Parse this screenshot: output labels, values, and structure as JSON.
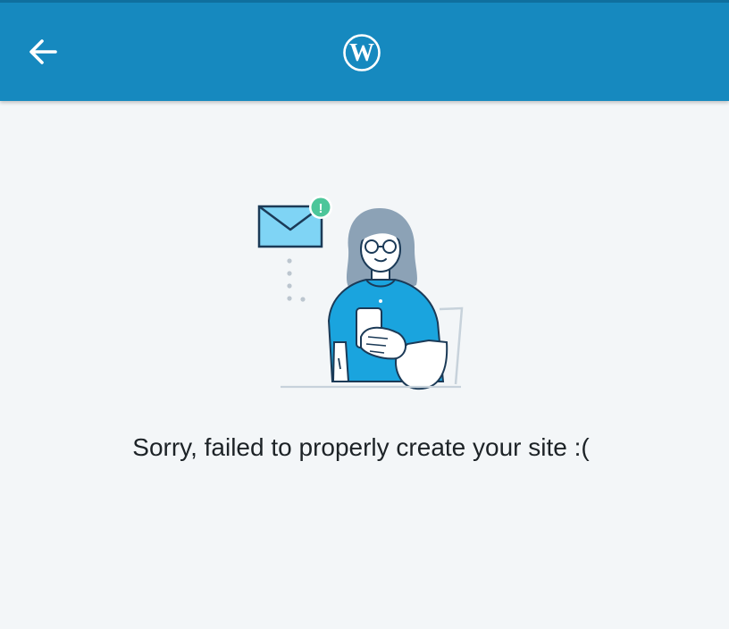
{
  "header": {
    "back_icon": "arrow-left-icon",
    "logo_icon": "wordpress-logo-icon",
    "background_color": "#1689bf"
  },
  "illustration": {
    "icon": "failed-site-illustration",
    "alert_badge": "!"
  },
  "message": {
    "text": "Sorry, failed to properly create your site :("
  }
}
